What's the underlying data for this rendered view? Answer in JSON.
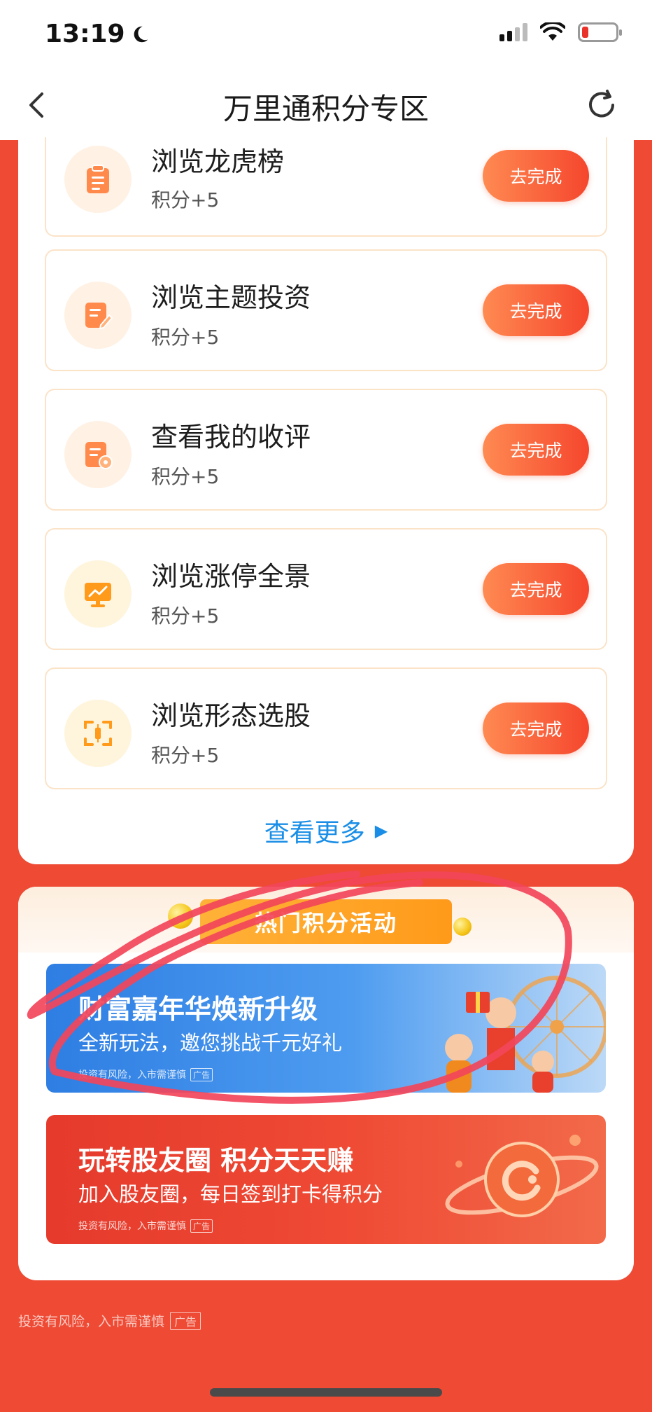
{
  "status_bar": {
    "time": "13:19",
    "moon_icon": "moon-icon",
    "signal_icon": "cellular-signal-icon",
    "wifi_icon": "wifi-icon",
    "battery_icon": "battery-low-icon"
  },
  "nav": {
    "title": "万里通积分专区",
    "back_icon": "chevron-left-icon",
    "refresh_icon": "refresh-icon"
  },
  "tasks": [
    {
      "title": "浏览龙虎榜",
      "points": "积分+5",
      "button": "去完成",
      "icon": "clipboard-icon"
    },
    {
      "title": "浏览主题投资",
      "points": "积分+5",
      "button": "去完成",
      "icon": "document-edit-icon"
    },
    {
      "title": "查看我的收评",
      "points": "积分+5",
      "button": "去完成",
      "icon": "document-settings-icon"
    },
    {
      "title": "浏览涨停全景",
      "points": "积分+5",
      "button": "去完成",
      "icon": "monitor-chart-icon"
    },
    {
      "title": "浏览形态选股",
      "points": "积分+5",
      "button": "去完成",
      "icon": "candlestick-scan-icon"
    }
  ],
  "see_more": {
    "label": "查看更多",
    "arrow": "▶"
  },
  "activities": {
    "header": "热门积分活动",
    "banners": [
      {
        "title": "财富嘉年华焕新升级",
        "subtitle": "全新玩法，邀您挑战千元好礼",
        "disclaimer": "投资有风险，入市需谨慎",
        "ad_tag": "广告"
      },
      {
        "title": "玩转股友圈 积分天天赚",
        "subtitle": "加入股友圈，每日签到打卡得积分",
        "disclaimer": "投资有风险，入市需谨慎",
        "ad_tag": "广告"
      }
    ]
  },
  "footer": {
    "disclaimer": "投资有风险，入市需谨慎",
    "ad_tag": "广告"
  },
  "colors": {
    "background": "#ee4a34",
    "button_start": "#ff8a52",
    "button_end": "#f5462d",
    "link": "#1a8ee6",
    "annotation": "#f2455a"
  }
}
